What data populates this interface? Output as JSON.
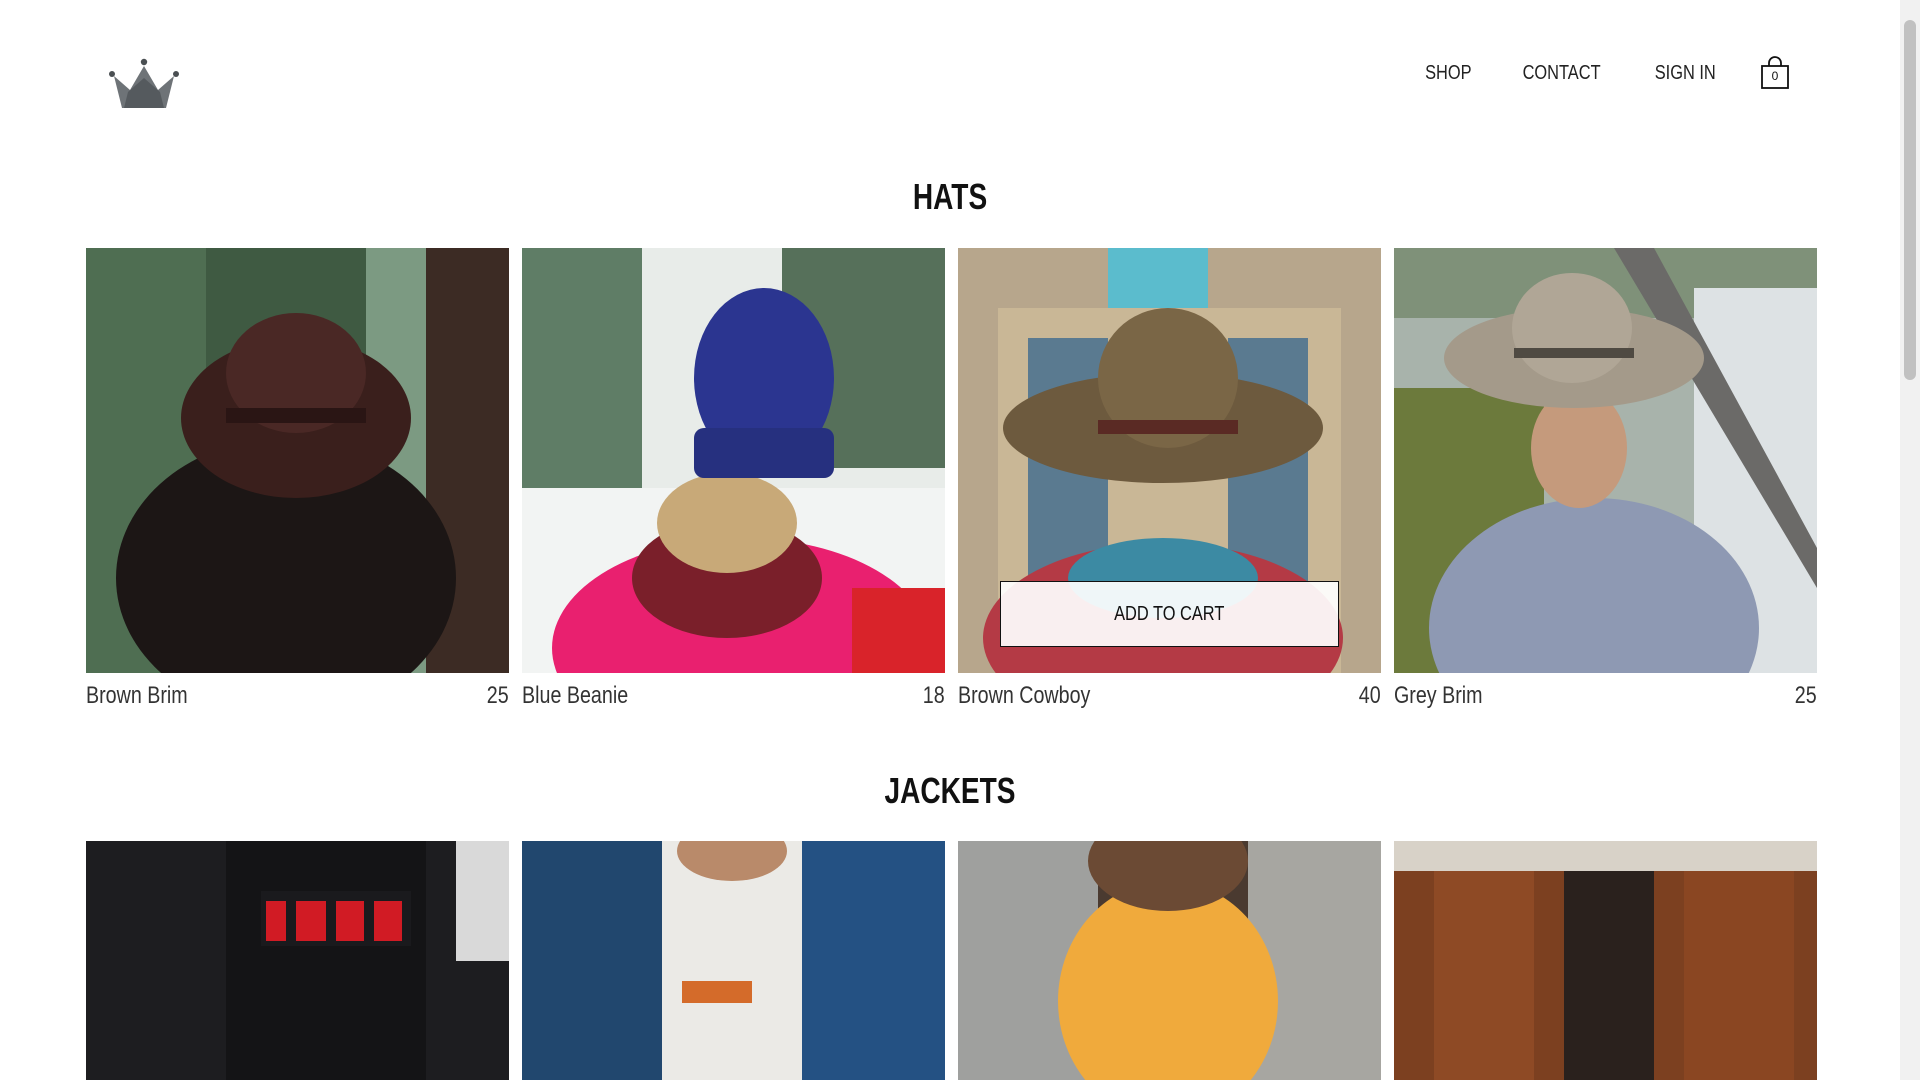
{
  "nav": {
    "shop": "SHOP",
    "contact": "CONTACT",
    "sign_in": "SIGN IN",
    "cart_count": "0"
  },
  "hats": {
    "title": "HATS",
    "items": [
      {
        "name": "Brown Brim",
        "price": "25"
      },
      {
        "name": "Blue Beanie",
        "price": "18"
      },
      {
        "name": "Brown Cowboy",
        "price": "40"
      },
      {
        "name": "Grey Brim",
        "price": "25"
      }
    ],
    "add_to_cart": "ADD TO CART"
  },
  "jackets": {
    "title": "JACKETS"
  },
  "colors": {
    "logo_gray": "#6e7377",
    "text": "#111111"
  }
}
